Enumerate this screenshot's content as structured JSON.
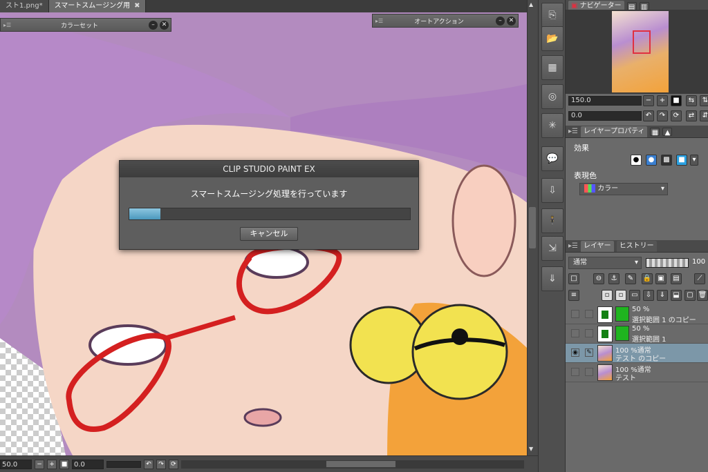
{
  "tabs": [
    {
      "label": "スト1.png*",
      "active": false
    },
    {
      "label": "スマートスムージング用",
      "active": true,
      "close": "✖"
    }
  ],
  "floating_panels": {
    "color_set": {
      "title": "カラーセット"
    },
    "auto_action": {
      "title": "オートアクション"
    }
  },
  "dialog": {
    "title": "CLIP STUDIO PAINT EX",
    "message": "スマートスムージング処理を行っています",
    "progress": 0.11,
    "cancel_label": "キャンセル"
  },
  "statusbar": {
    "zoom": "50.0",
    "angle": "0.0"
  },
  "navigator": {
    "title": "ナビゲーター",
    "zoom": "150.0",
    "angle": "0.0"
  },
  "layer_property": {
    "title": "レイヤープロパティ",
    "effect_label": "効果",
    "color_mode_label": "表現色",
    "color_mode_value": "カラー"
  },
  "layers_panel": {
    "tab_layer": "レイヤー",
    "tab_history": "ヒストリー",
    "blend_mode": "通常",
    "opacity": "100",
    "layers": [
      {
        "line1": "50 %",
        "line2": "選択範囲 1 のコピー",
        "visible": false,
        "selected": false,
        "mask": true
      },
      {
        "line1": "50 %",
        "line2": "選択範囲 1",
        "visible": false,
        "selected": false,
        "mask": true
      },
      {
        "line1": "100 %通常",
        "line2": "テスト のコピー",
        "visible": true,
        "selected": true,
        "mask": false
      },
      {
        "line1": "100 %通常",
        "line2": "テスト",
        "visible": false,
        "selected": false,
        "mask": false
      }
    ]
  },
  "colors": {
    "accent": "#4b98bd",
    "hair": "#b38bbf",
    "glasses": "#d42020",
    "bell": "#f2e250"
  }
}
